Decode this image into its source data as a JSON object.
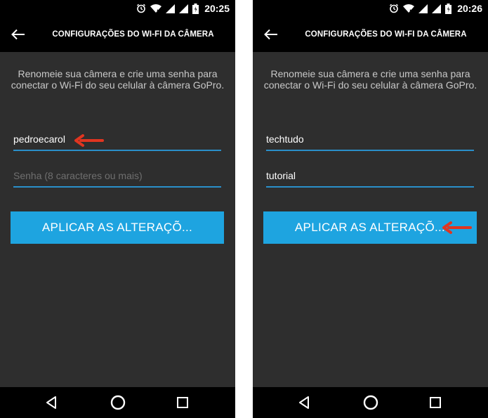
{
  "colors": {
    "accent": "#1ea4e0",
    "underline": "#2a8fc9",
    "arrow": "#e03520",
    "screen_bg": "#2e2e2e"
  },
  "screens": [
    {
      "status": {
        "time": "20:25",
        "icons": [
          "alarm-icon",
          "wifi-icon",
          "signal-icon",
          "signal-icon",
          "battery-icon"
        ]
      },
      "app_bar": {
        "back_icon": "arrow-left-icon",
        "title": "CONFIGURAÇÕES DO WI-FI DA CÂMERA"
      },
      "instructions": "Renomeie sua câmera e crie uma senha para conectar o Wi-Fi do seu celular à câmera GoPro.",
      "camera_name": {
        "value": "pedroecarol",
        "placeholder": ""
      },
      "password": {
        "value": "",
        "placeholder": "Senha (8 caracteres ou mais)"
      },
      "apply_button": "APLICAR AS ALTERAÇÕ...",
      "annotation_arrow": "pointing-to-name-field",
      "nav": [
        "back-triangle-icon",
        "home-circle-icon",
        "recents-square-icon"
      ]
    },
    {
      "status": {
        "time": "20:26",
        "icons": [
          "alarm-icon",
          "wifi-icon",
          "signal-icon",
          "signal-icon",
          "battery-icon"
        ]
      },
      "app_bar": {
        "back_icon": "arrow-left-icon",
        "title": "CONFIGURAÇÕES DO WI-FI DA CÂMERA"
      },
      "instructions": "Renomeie sua câmera e crie uma senha para conectar o Wi-Fi do seu celular à câmera GoPro.",
      "camera_name": {
        "value": "techtudo",
        "placeholder": ""
      },
      "password": {
        "value": "tutorial",
        "placeholder": ""
      },
      "apply_button": "APLICAR AS ALTERAÇÕ...",
      "annotation_arrow": "pointing-to-apply-button",
      "nav": [
        "back-triangle-icon",
        "home-circle-icon",
        "recents-square-icon"
      ]
    }
  ]
}
